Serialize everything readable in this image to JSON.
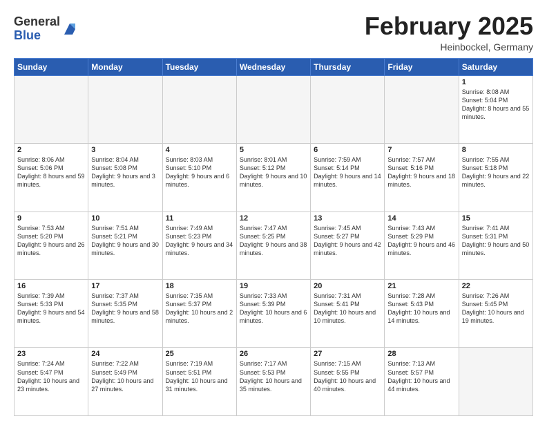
{
  "header": {
    "logo_general": "General",
    "logo_blue": "Blue",
    "month_year": "February 2025",
    "location": "Heinbockel, Germany"
  },
  "days_of_week": [
    "Sunday",
    "Monday",
    "Tuesday",
    "Wednesday",
    "Thursday",
    "Friday",
    "Saturday"
  ],
  "weeks": [
    {
      "days": [
        {
          "num": "",
          "info": "",
          "empty": true
        },
        {
          "num": "",
          "info": "",
          "empty": true
        },
        {
          "num": "",
          "info": "",
          "empty": true
        },
        {
          "num": "",
          "info": "",
          "empty": true
        },
        {
          "num": "",
          "info": "",
          "empty": true
        },
        {
          "num": "",
          "info": "",
          "empty": true
        },
        {
          "num": "1",
          "info": "Sunrise: 8:08 AM\nSunset: 5:04 PM\nDaylight: 8 hours and 55 minutes.",
          "empty": false
        }
      ]
    },
    {
      "days": [
        {
          "num": "2",
          "info": "Sunrise: 8:06 AM\nSunset: 5:06 PM\nDaylight: 8 hours and 59 minutes.",
          "empty": false
        },
        {
          "num": "3",
          "info": "Sunrise: 8:04 AM\nSunset: 5:08 PM\nDaylight: 9 hours and 3 minutes.",
          "empty": false
        },
        {
          "num": "4",
          "info": "Sunrise: 8:03 AM\nSunset: 5:10 PM\nDaylight: 9 hours and 6 minutes.",
          "empty": false
        },
        {
          "num": "5",
          "info": "Sunrise: 8:01 AM\nSunset: 5:12 PM\nDaylight: 9 hours and 10 minutes.",
          "empty": false
        },
        {
          "num": "6",
          "info": "Sunrise: 7:59 AM\nSunset: 5:14 PM\nDaylight: 9 hours and 14 minutes.",
          "empty": false
        },
        {
          "num": "7",
          "info": "Sunrise: 7:57 AM\nSunset: 5:16 PM\nDaylight: 9 hours and 18 minutes.",
          "empty": false
        },
        {
          "num": "8",
          "info": "Sunrise: 7:55 AM\nSunset: 5:18 PM\nDaylight: 9 hours and 22 minutes.",
          "empty": false
        }
      ]
    },
    {
      "days": [
        {
          "num": "9",
          "info": "Sunrise: 7:53 AM\nSunset: 5:20 PM\nDaylight: 9 hours and 26 minutes.",
          "empty": false
        },
        {
          "num": "10",
          "info": "Sunrise: 7:51 AM\nSunset: 5:21 PM\nDaylight: 9 hours and 30 minutes.",
          "empty": false
        },
        {
          "num": "11",
          "info": "Sunrise: 7:49 AM\nSunset: 5:23 PM\nDaylight: 9 hours and 34 minutes.",
          "empty": false
        },
        {
          "num": "12",
          "info": "Sunrise: 7:47 AM\nSunset: 5:25 PM\nDaylight: 9 hours and 38 minutes.",
          "empty": false
        },
        {
          "num": "13",
          "info": "Sunrise: 7:45 AM\nSunset: 5:27 PM\nDaylight: 9 hours and 42 minutes.",
          "empty": false
        },
        {
          "num": "14",
          "info": "Sunrise: 7:43 AM\nSunset: 5:29 PM\nDaylight: 9 hours and 46 minutes.",
          "empty": false
        },
        {
          "num": "15",
          "info": "Sunrise: 7:41 AM\nSunset: 5:31 PM\nDaylight: 9 hours and 50 minutes.",
          "empty": false
        }
      ]
    },
    {
      "days": [
        {
          "num": "16",
          "info": "Sunrise: 7:39 AM\nSunset: 5:33 PM\nDaylight: 9 hours and 54 minutes.",
          "empty": false
        },
        {
          "num": "17",
          "info": "Sunrise: 7:37 AM\nSunset: 5:35 PM\nDaylight: 9 hours and 58 minutes.",
          "empty": false
        },
        {
          "num": "18",
          "info": "Sunrise: 7:35 AM\nSunset: 5:37 PM\nDaylight: 10 hours and 2 minutes.",
          "empty": false
        },
        {
          "num": "19",
          "info": "Sunrise: 7:33 AM\nSunset: 5:39 PM\nDaylight: 10 hours and 6 minutes.",
          "empty": false
        },
        {
          "num": "20",
          "info": "Sunrise: 7:31 AM\nSunset: 5:41 PM\nDaylight: 10 hours and 10 minutes.",
          "empty": false
        },
        {
          "num": "21",
          "info": "Sunrise: 7:28 AM\nSunset: 5:43 PM\nDaylight: 10 hours and 14 minutes.",
          "empty": false
        },
        {
          "num": "22",
          "info": "Sunrise: 7:26 AM\nSunset: 5:45 PM\nDaylight: 10 hours and 19 minutes.",
          "empty": false
        }
      ]
    },
    {
      "days": [
        {
          "num": "23",
          "info": "Sunrise: 7:24 AM\nSunset: 5:47 PM\nDaylight: 10 hours and 23 minutes.",
          "empty": false
        },
        {
          "num": "24",
          "info": "Sunrise: 7:22 AM\nSunset: 5:49 PM\nDaylight: 10 hours and 27 minutes.",
          "empty": false
        },
        {
          "num": "25",
          "info": "Sunrise: 7:19 AM\nSunset: 5:51 PM\nDaylight: 10 hours and 31 minutes.",
          "empty": false
        },
        {
          "num": "26",
          "info": "Sunrise: 7:17 AM\nSunset: 5:53 PM\nDaylight: 10 hours and 35 minutes.",
          "empty": false
        },
        {
          "num": "27",
          "info": "Sunrise: 7:15 AM\nSunset: 5:55 PM\nDaylight: 10 hours and 40 minutes.",
          "empty": false
        },
        {
          "num": "28",
          "info": "Sunrise: 7:13 AM\nSunset: 5:57 PM\nDaylight: 10 hours and 44 minutes.",
          "empty": false
        },
        {
          "num": "",
          "info": "",
          "empty": true
        }
      ]
    }
  ]
}
